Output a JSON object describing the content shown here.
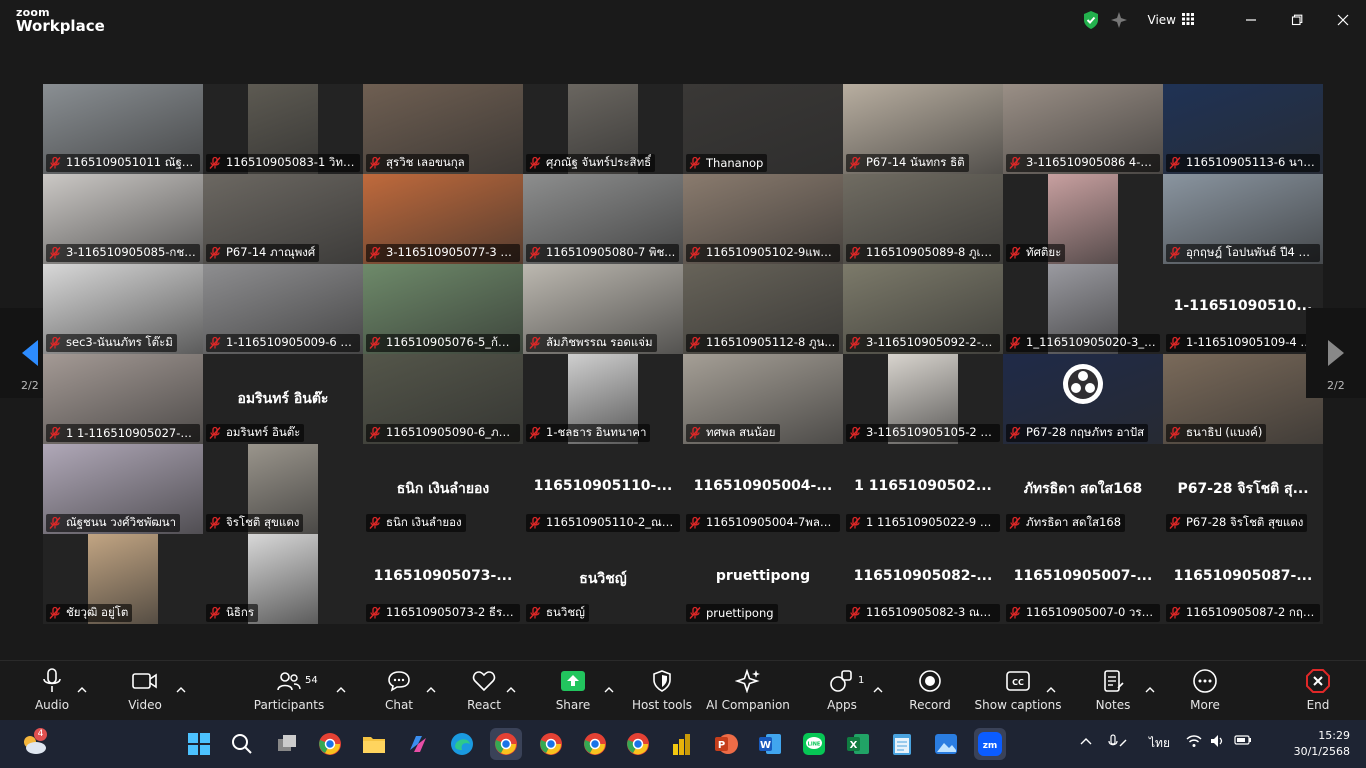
{
  "app": {
    "brand_line1": "zoom",
    "brand_line2": "Workplace",
    "view_label": "View"
  },
  "pagination": {
    "left": "2/2",
    "right": "2/2"
  },
  "participants": [
    {
      "label": "1165109051011 ณัฐพ...",
      "video": "#8a8f93"
    },
    {
      "label": "116510905083-1 วิทวัส",
      "video": "#5d5a52"
    },
    {
      "label": "สุรวิช เลอขนกุล",
      "video": "#6f5f52"
    },
    {
      "label": "ศุภณัฐ จันทร์ประสิทธิ์",
      "video": "#6a6660"
    },
    {
      "label": "Thananop",
      "video": "#3a3836"
    },
    {
      "label": "P67-14 นันทกร ธิติ",
      "video": "#b8aea0"
    },
    {
      "label": "3-116510905086 4-แก้...",
      "video": "#9a8f86"
    },
    {
      "label": "116510905113-6 นาย ...",
      "video": "#1f3255"
    },
    {
      "label": "3-116510905085-กชพ...",
      "video": "#cbc8c5"
    },
    {
      "label": "P67-14 ภาณุพงศ์",
      "video": "#6c6862"
    },
    {
      "label": "3-116510905077-3 จิ...",
      "video": "#c06a3c"
    },
    {
      "label": "116510905080-7 พิช...",
      "video": "#8d8e8e"
    },
    {
      "label": "116510905102-9แพรท...",
      "video": "#8a7b6e"
    },
    {
      "label": "116510905089-8 ภูเน...",
      "video": "#706c62"
    },
    {
      "label": "ทัศติยะ",
      "video": "#c8a0a0"
    },
    {
      "label": "อุกฤษฎ์ โอปนพันธ์ ปี4 1...",
      "video": "#8a95a0"
    },
    {
      "label": "sec3-นันนภัทร โต๊ะมิ",
      "video": "#d8d8d8"
    },
    {
      "label": "1-116510905009-6 พ...",
      "video": "#8e8e90"
    },
    {
      "label": "116510905076-5_ก้อย...",
      "video": "#6e8a6a"
    },
    {
      "label": "ลัมภิชพรรณ รอดแจ่ม",
      "video": "#bcb8b0"
    },
    {
      "label": "116510905112-8 ภูน...",
      "video": "#676359"
    },
    {
      "label": "3-116510905092-2-วุ...",
      "video": "#7c7a6a"
    },
    {
      "label": "1_116510905020-3_ฐา...",
      "video": "#9a9aa0"
    },
    {
      "label": "1-116510905109-4 ก...",
      "cam_name": "1-11651090510...",
      "video": ""
    },
    {
      "label": "1 1-116510905027-8 ...",
      "video": "#a49a95"
    },
    {
      "label": "อมรินทร์ อินต๊ะ",
      "cam_name": "อมรินทร์ อินต๊ะ",
      "video": ""
    },
    {
      "label": "116510905090-6_ภาคิ...",
      "video": "#54564a"
    },
    {
      "label": "1-ชลธาร อินทนาคา",
      "video": "#cfcfcf"
    },
    {
      "label": "ทศพล สนน้อย",
      "video": "#a59f96"
    },
    {
      "label": "3-116510905105-2 ภั...",
      "video": "#d8d4ce"
    },
    {
      "label": "P67-28 กฤษภัทร อาปัส",
      "video": "#1f2a48"
    },
    {
      "label": "ธนาธิป (แบงค์)",
      "video": "#7a6a5a"
    },
    {
      "label": "ณัฐชนน วงศ์วิชพัฒนา",
      "video": "#b0a8b8"
    },
    {
      "label": "จิรโชติ สุขแดง",
      "video": "#9a958c"
    },
    {
      "label": "ธนิก เงินลำยอง",
      "cam_name": "ธนิก เงินลำยอง",
      "video": ""
    },
    {
      "label": "116510905110-2_ณภั...",
      "cam_name": "116510905110-...",
      "video": ""
    },
    {
      "label": "116510905004-7พลอย...",
      "cam_name": "116510905004-...",
      "video": ""
    },
    {
      "label": "1 116510905022-9 ทิ...",
      "cam_name": "1 11651090502...",
      "video": ""
    },
    {
      "label": "ภัทรธิดา สดใส168",
      "cam_name": "ภัทรธิดา สดใส168",
      "video": ""
    },
    {
      "label": "P67-28 จิรโชติ สุขแดง",
      "cam_name": "P67-28 จิรโชติ สุ...",
      "video": ""
    },
    {
      "label": "ชัยวุฒิ อยู่โต",
      "video": "#c2a583"
    },
    {
      "label": "นิธิกร",
      "video": "#d8d8d8"
    },
    {
      "label": "116510905073-2 ธีรเมธ",
      "cam_name": "116510905073-...",
      "video": ""
    },
    {
      "label": "ธนวิชญ์",
      "cam_name": "ธนวิชญ์",
      "video": ""
    },
    {
      "label": "pruettipong",
      "cam_name": "pruettipong",
      "video": ""
    },
    {
      "label": "116510905082-3 ณรวิช...",
      "cam_name": "116510905082-...",
      "video": ""
    },
    {
      "label": "116510905007-0 วรเดช",
      "cam_name": "116510905007-...",
      "video": ""
    },
    {
      "label": "116510905087-2 กฤษ...",
      "cam_name": "116510905087-...",
      "video": ""
    }
  ],
  "toolbar": {
    "audio": "Audio",
    "video": "Video",
    "participants": "Participants",
    "participants_count": "54",
    "chat": "Chat",
    "react": "React",
    "share": "Share",
    "host_tools": "Host tools",
    "ai_companion": "AI Companion",
    "apps": "Apps",
    "apps_count": "1",
    "record": "Record",
    "show_captions": "Show captions",
    "notes": "Notes",
    "more": "More",
    "end": "End"
  },
  "taskbar": {
    "weather_badge": "4",
    "language": "ไทย",
    "time": "15:29",
    "date": "30/1/2568"
  }
}
